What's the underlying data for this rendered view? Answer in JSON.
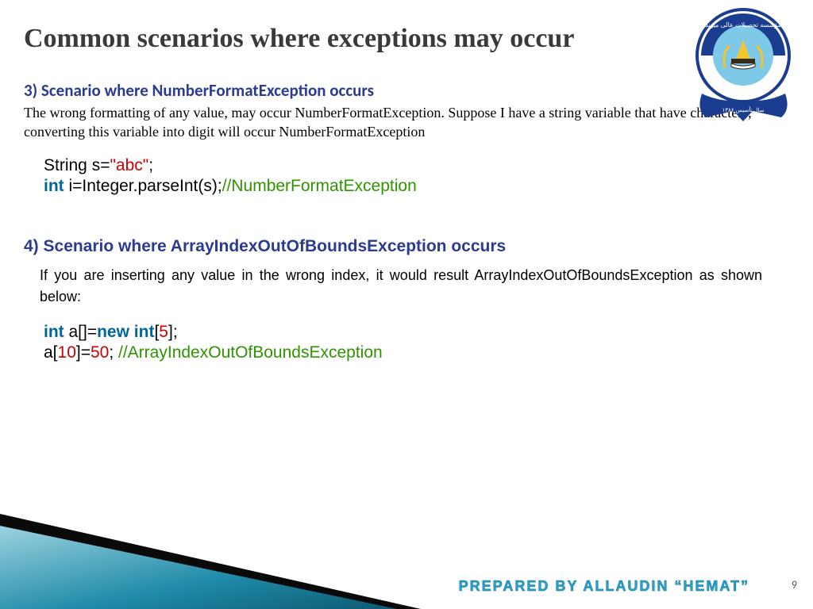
{
  "title": "Common scenarios where exceptions may occur",
  "section3": {
    "heading": "3) Scenario where NumberFormatException occurs",
    "text": "The wrong formatting of any value, may occur NumberFormatException. Suppose I have a string variable that have characters, converting this variable into digit will occur NumberFormatException",
    "code": {
      "l1a": "String s=",
      "l1b": "\"abc\"",
      "l1c": ";",
      "l2a": "int",
      "l2b": " i=Integer.parseInt(s);",
      "l2c": "//NumberFormatException"
    }
  },
  "section4": {
    "heading": "4) Scenario where ArrayIndexOutOfBoundsException occurs",
    "text": "If you are inserting any value in the wrong index, it would result ArrayIndexOutOfBoundsException as shown below:",
    "code": {
      "l1a": "int",
      "l1b": " a[]=",
      "l1c": "new int",
      "l1d": "[",
      "l1e": "5",
      "l1f": "];",
      "l2a": "a[",
      "l2b": "10",
      "l2c": "]=",
      "l2d": "50",
      "l2e": "; ",
      "l2f": "//ArrayIndexOutOfBoundsException"
    }
  },
  "footer": "PREPARED BY ALLAUDIN “HEMAT”",
  "page": "9",
  "logo": {
    "top_text": "مؤسسه تحصیلات عالی میوند",
    "bottom_text": "سال تأسیس ۱۳۸۶"
  }
}
